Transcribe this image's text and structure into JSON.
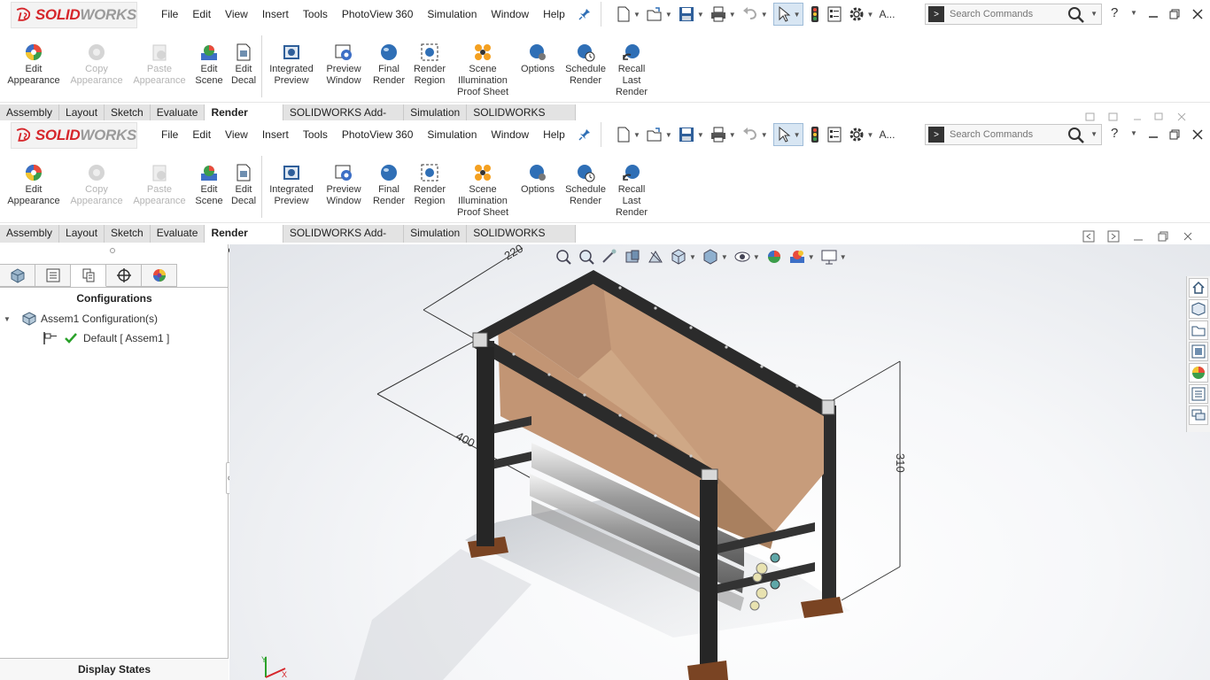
{
  "app": {
    "logo_text_1": "SOLIDWORKS",
    "logo_text_solid": "SOLID",
    "logo_text_works": "WORKS"
  },
  "menu": [
    "File",
    "Edit",
    "View",
    "Insert",
    "Tools",
    "PhotoView 360",
    "Simulation",
    "Window",
    "Help"
  ],
  "qat": {
    "a_label": "A...",
    "search_placeholder": "Search Commands",
    "help": "?"
  },
  "tools": [
    {
      "line1": "Edit",
      "line2": "Appearance",
      "line3": "",
      "disabled": false,
      "icon": "edit-appearance-icon"
    },
    {
      "line1": "Copy",
      "line2": "Appearance",
      "line3": "",
      "disabled": true,
      "icon": "copy-appearance-icon"
    },
    {
      "line1": "Paste",
      "line2": "Appearance",
      "line3": "",
      "disabled": true,
      "icon": "paste-appearance-icon"
    },
    {
      "line1": "Edit",
      "line2": "Scene",
      "line3": "",
      "disabled": false,
      "icon": "edit-scene-icon"
    },
    {
      "line1": "Edit",
      "line2": "Decal",
      "line3": "",
      "disabled": false,
      "icon": "edit-decal-icon"
    },
    {
      "line1": "Integrated",
      "line2": "Preview",
      "line3": "",
      "disabled": false,
      "icon": "integrated-preview-icon"
    },
    {
      "line1": "Preview",
      "line2": "Window",
      "line3": "",
      "disabled": false,
      "icon": "preview-window-icon"
    },
    {
      "line1": "Final",
      "line2": "Render",
      "line3": "",
      "disabled": false,
      "icon": "final-render-icon"
    },
    {
      "line1": "Render",
      "line2": "Region",
      "line3": "",
      "disabled": false,
      "icon": "render-region-icon"
    },
    {
      "line1": "Scene",
      "line2": "Illumination",
      "line3": "Proof Sheet",
      "disabled": false,
      "icon": "scene-illumination-icon"
    },
    {
      "line1": "Options",
      "line2": "",
      "line3": "",
      "disabled": false,
      "icon": "options-icon"
    },
    {
      "line1": "Schedule",
      "line2": "Render",
      "line3": "",
      "disabled": false,
      "icon": "schedule-render-icon"
    },
    {
      "line1": "Recall",
      "line2": "Last",
      "line3": "Render",
      "disabled": false,
      "icon": "recall-last-render-icon"
    }
  ],
  "tabs": [
    {
      "label": "Assembly",
      "active": false
    },
    {
      "label": "Layout",
      "active": false
    },
    {
      "label": "Sketch",
      "active": false
    },
    {
      "label": "Evaluate",
      "active": false
    },
    {
      "label": "Render Tools",
      "active": true
    },
    {
      "label": "SOLIDWORKS Add-Ins",
      "active": false
    },
    {
      "label": "Simulation",
      "active": false
    },
    {
      "label": "SOLIDWORKS MBD",
      "active": false
    }
  ],
  "pane": {
    "title": "Configurations",
    "root": "Assem1 Configuration(s)",
    "child": "Default [ Assem1 ]",
    "footer": "Display States"
  },
  "dimensions": {
    "d1": "220",
    "d2": "400",
    "d3": "310"
  },
  "colors": {
    "brand_red": "#d6262b",
    "active_tab": "#ffffff",
    "hopper": "#c9a081",
    "frame": "#2f2f2f"
  }
}
